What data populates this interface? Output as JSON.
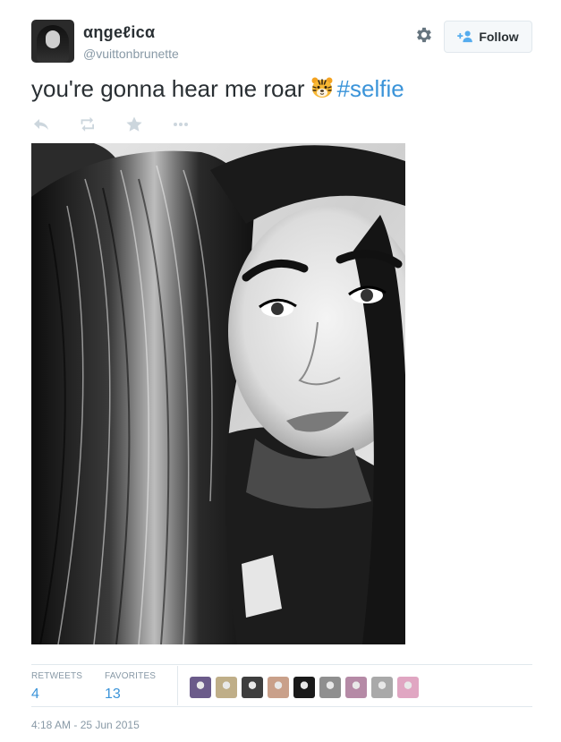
{
  "user": {
    "display_name": "αηgeℓicα",
    "handle": "@vuittonbrunette"
  },
  "follow_button": {
    "label": "Follow"
  },
  "tweet": {
    "text_main": "you're gonna hear me roar",
    "emoji": "tiger-face-icon",
    "hashtag": "#selfie"
  },
  "actions": [
    "reply-icon",
    "retweet-icon",
    "favorite-icon",
    "more-icon"
  ],
  "stats": {
    "retweets_label": "RETWEETS",
    "retweets_count": "4",
    "favorites_label": "FAVORITES",
    "favorites_count": "13"
  },
  "favoriter_avatars": [
    "#6b5b8a",
    "#bfae88",
    "#3e3e3e",
    "#c9a08a",
    "#1a1a1a",
    "#8f8f8f",
    "#b58aa6",
    "#a9a9a9",
    "#e0a6c2"
  ],
  "timestamp": "4:18 AM - 25 Jun 2015",
  "colors": {
    "link": "#3b94d9",
    "meta": "#8899a6",
    "text": "#292f33"
  }
}
